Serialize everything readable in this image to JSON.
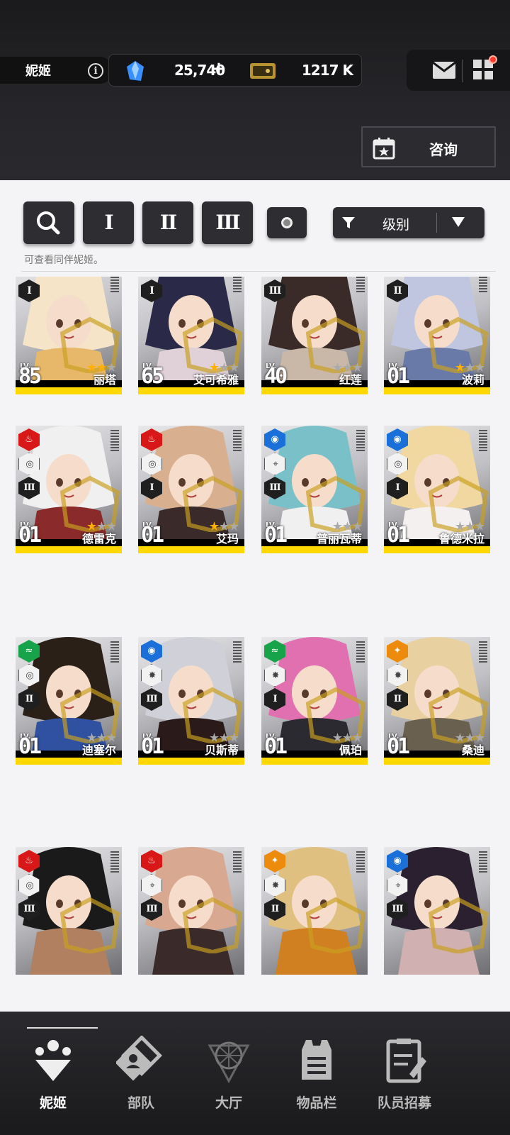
{
  "header": {
    "title": "妮姬",
    "gem_count": "25,740",
    "gem_plus": "+",
    "credit_count": "1217 K",
    "consult_label": "咨询"
  },
  "toolbar": {
    "buttons": [
      {
        "label": "I"
      },
      {
        "label": "II"
      },
      {
        "label": "III"
      }
    ],
    "sort_label": "级别",
    "hint": "可查看同伴妮姬。"
  },
  "colors": {
    "fire": "#d81818",
    "water": "#1a6fd8",
    "wind": "#16a34a",
    "iron": "#ec8b0c",
    "footer_yellow": "#ffd800",
    "star_on": "#ffb000",
    "badge_red": "#ff3b30"
  },
  "cards": [
    {
      "name": "丽塔",
      "lv_label": "LV.",
      "level": "85",
      "burst": "I",
      "stars": 2
    },
    {
      "name": "艾可希雅",
      "lv_label": "LV.",
      "level": "65",
      "burst": "I",
      "stars": 1
    },
    {
      "name": "红莲",
      "lv_label": "LV.",
      "level": "40",
      "burst": "III",
      "stars": 0
    },
    {
      "name": "波莉",
      "lv_label": "LV.",
      "level": "01",
      "burst": "II",
      "stars": 1
    },
    {
      "name": "德雷克",
      "lv_label": "LV.",
      "level": "01",
      "element": "fire",
      "class_icon": "defender",
      "burst": "III",
      "stars": 1
    },
    {
      "name": "艾玛",
      "lv_label": "LV.",
      "level": "01",
      "element": "fire",
      "class_icon": "defender",
      "burst": "I",
      "stars": 1
    },
    {
      "name": "普丽瓦蒂",
      "lv_label": "LV.",
      "level": "01",
      "element": "water",
      "class_icon": "attacker",
      "burst": "III",
      "stars": 0
    },
    {
      "name": "鲁德米拉",
      "lv_label": "LV.",
      "level": "01",
      "element": "water",
      "class_icon": "defender",
      "burst": "I",
      "stars": 0
    },
    {
      "name": "迪塞尔",
      "lv_label": "LV.",
      "level": "01",
      "element": "wind",
      "class_icon": "defender",
      "burst": "II",
      "stars": 0
    },
    {
      "name": "贝斯蒂",
      "lv_label": "LV.",
      "level": "01",
      "element": "water",
      "class_icon": "supporter",
      "burst": "III",
      "stars": 0
    },
    {
      "name": "佩珀",
      "lv_label": "LV.",
      "level": "01",
      "element": "wind",
      "class_icon": "supporter",
      "burst": "I",
      "stars": 0
    },
    {
      "name": "桑迪",
      "lv_label": "LV.",
      "level": "01",
      "element": "iron",
      "class_icon": "supporter",
      "burst": "II",
      "stars": 0
    },
    {
      "name": "",
      "element": "fire",
      "class_icon": "defender",
      "burst": "III"
    },
    {
      "name": "",
      "element": "fire",
      "class_icon": "attacker",
      "burst": "III"
    },
    {
      "name": "",
      "element": "iron",
      "class_icon": "supporter",
      "burst": "II"
    },
    {
      "name": "",
      "element": "water",
      "class_icon": "attacker",
      "burst": "III"
    }
  ],
  "nav": [
    {
      "label": "妮姬",
      "icon": "nikke-icon",
      "active": true
    },
    {
      "label": "部队",
      "icon": "squad-icon"
    },
    {
      "label": "大厅",
      "icon": "lobby-icon"
    },
    {
      "label": "物品栏",
      "icon": "inventory-icon"
    },
    {
      "label": "队员招募",
      "icon": "recruit-icon"
    }
  ]
}
